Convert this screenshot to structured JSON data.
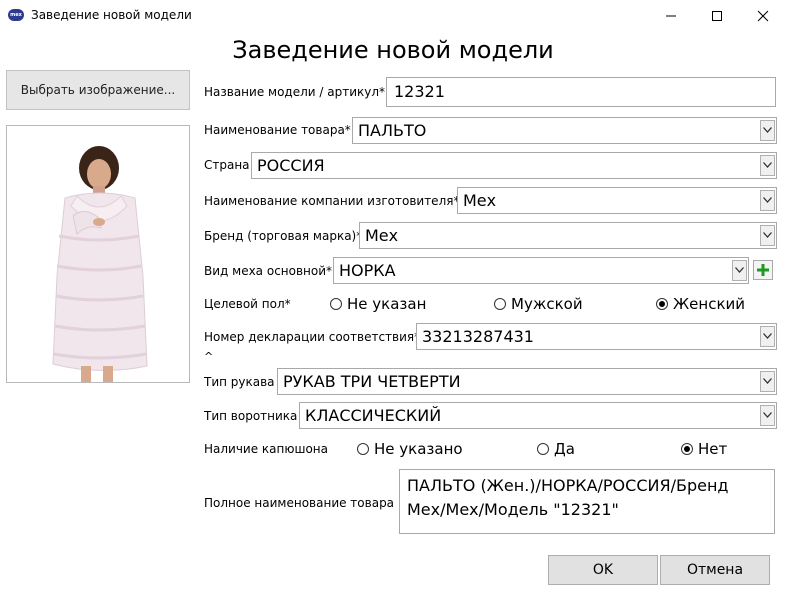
{
  "window": {
    "title": "Заведение новой модели",
    "app_icon_text": "mex",
    "controls": {
      "minimize": "—",
      "maximize": "☐",
      "close": "✕"
    }
  },
  "page_title": "Заведение новой модели",
  "left": {
    "choose_image_label": "Выбрать изображение...",
    "photo_icon": "fur-coat-model-photo"
  },
  "form": {
    "model_name": {
      "label": "Название модели / артикул*",
      "value": "12321"
    },
    "product_name": {
      "label": "Наименование товара*",
      "value": "ПАЛЬТО"
    },
    "country": {
      "label": "Страна",
      "value": "РОССИЯ"
    },
    "manufacturer": {
      "label": "Наименование компании изготовителя*",
      "value": "Мех"
    },
    "brand": {
      "label": "Бренд (торговая марка)*",
      "value": "Мех"
    },
    "fur_type": {
      "label": "Вид меха основной*",
      "value": "НОРКА",
      "add_icon": "plus-icon"
    },
    "gender": {
      "label": "Целевой пол*",
      "options": [
        "Не указан",
        "Мужской",
        "Женский"
      ],
      "selected": 2
    },
    "declaration": {
      "label": "Номер декларации соответствия*",
      "value": "33213287431"
    },
    "collapse_glyph": "^",
    "sleeve": {
      "label": "Тип рукава",
      "value": "РУКАВ ТРИ ЧЕТВЕРТИ"
    },
    "collar": {
      "label": "Тип воротника",
      "value": "КЛАССИЧЕСКИЙ"
    },
    "hood": {
      "label": "Наличие капюшона",
      "options": [
        "Не указано",
        "Да",
        "Нет"
      ],
      "selected": 2
    },
    "full_name": {
      "label": "Полное наименование товара",
      "line1": "ПАЛЬТО (Жен.)/НОРКА/РОССИЯ/Бренд",
      "line2": "Мех/Мех/Модель \"12321\""
    }
  },
  "buttons": {
    "ok": "OK",
    "cancel": "Отмена"
  },
  "colors": {
    "plus_green": "#1e9a1e",
    "button_bg": "#e1e1e1",
    "border": "#a9a9a9"
  }
}
